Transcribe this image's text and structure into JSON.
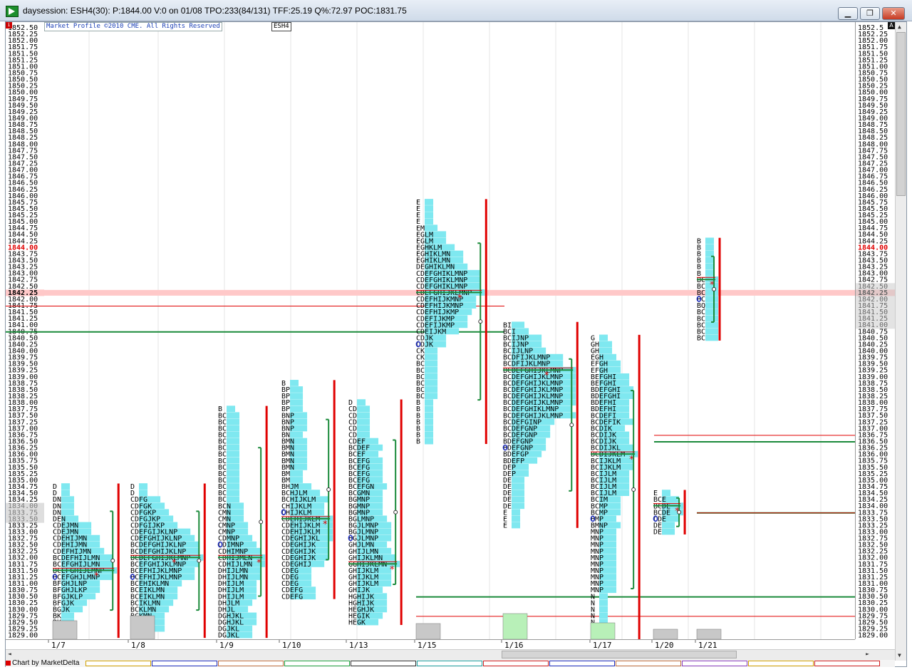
{
  "window": {
    "title": "daysession: ESH4(30): P:1844.00 V:0 on 01/08 TPO:233(84/131) TFF:25.19 Q%:72.97 POC:1831.75",
    "minimize_label": "▁",
    "maximize_label": "❐",
    "close_label": "✕"
  },
  "chart_header": {
    "copyright": "Market Profile ©2010 CME. All Rights Reserved",
    "symbol": "ESH4",
    "left_marker": "i",
    "right_marker": "A"
  },
  "status": {
    "caption": "Chart by MarketDelta",
    "tab_colors": [
      "#d0a000",
      "#1f2fbf",
      "#c07040",
      "#20a040",
      "#303030",
      "#20a0a0",
      "#d02020",
      "#1f2fbf",
      "#c07040",
      "#8a3fbf",
      "#d0a000",
      "#d02020"
    ]
  },
  "scrollbars": {
    "up_icon": "▲",
    "down_icon": "▼",
    "left_icon": "◄",
    "right_icon": "►"
  },
  "price_axis": {
    "labels": [
      "1852.50",
      "1852.25",
      "1852.00",
      "1851.75",
      "1851.50",
      "1851.25",
      "1851.00",
      "1850.75",
      "1850.50",
      "1850.25",
      "1850.00",
      "1849.75",
      "1849.50",
      "1849.25",
      "1849.00",
      "1848.75",
      "1848.50",
      "1848.25",
      "1848.00",
      "1847.75",
      "1847.50",
      "1847.25",
      "1847.00",
      "1846.75",
      "1846.50",
      "1846.25",
      "1846.00",
      "1845.75",
      "1845.50",
      "1845.25",
      "1845.00",
      "1844.75",
      "1844.50",
      "1844.25",
      "1844.00",
      "1843.75",
      "1843.50",
      "1843.25",
      "1843.00",
      "1842.75",
      "1842.50",
      "1842.25",
      "1842.00",
      "1841.75",
      "1841.50",
      "1841.25",
      "1841.00",
      "1840.75",
      "1840.50",
      "1840.25",
      "1840.00",
      "1839.75",
      "1839.50",
      "1839.25",
      "1839.00",
      "1838.75",
      "1838.50",
      "1838.25",
      "1838.00",
      "1837.75",
      "1837.50",
      "1837.25",
      "1837.00",
      "1836.75",
      "1836.50",
      "1836.25",
      "1836.00",
      "1835.75",
      "1835.50",
      "1835.25",
      "1835.00",
      "1834.75",
      "1834.50",
      "1834.25",
      "1834.00",
      "1833.75",
      "1833.50",
      "1833.25",
      "1833.00",
      "1832.75",
      "1832.50",
      "1832.25",
      "1832.00",
      "1831.75",
      "1831.50",
      "1831.25",
      "1831.00",
      "1830.75",
      "1830.50",
      "1830.25",
      "1830.00",
      "1829.75",
      "1829.50",
      "1829.25",
      "1829.00"
    ],
    "right_labels": [
      "1852.5",
      "1852.25",
      "1852.00",
      "1851.75",
      "1851.50",
      "1851.25",
      "1851.00",
      "1850.75",
      "1850.50",
      "1850.25",
      "1850.00",
      "1849.75",
      "1849.50",
      "1849.25",
      "1849.00",
      "1848.75",
      "1848.50",
      "1848.25",
      "1848.00",
      "1847.75",
      "1847.50",
      "1847.25",
      "1847.00",
      "1846.75",
      "1846.50",
      "1846.25",
      "1846.00",
      "1845.75",
      "1845.50",
      "1845.25",
      "1845.00",
      "1844.75",
      "1844.50",
      "1844.25",
      "1844.00",
      "1843.75",
      "1843.50",
      "1843.25",
      "1843.00",
      "1842.75",
      "1842.50",
      "1842.25",
      "1842.00",
      "1841.75",
      "1841.50",
      "1841.25",
      "1841.00",
      "1840.75",
      "1840.50",
      "1840.25",
      "1840.00",
      "1839.75",
      "1839.50",
      "1839.25",
      "1839.00",
      "1838.75",
      "1838.50",
      "1838.25",
      "1838.00",
      "1837.75",
      "1837.50",
      "1837.25",
      "1837.00",
      "1836.75",
      "1836.50",
      "1836.25",
      "1836.00",
      "1835.75",
      "1835.50",
      "1835.25",
      "1835.00",
      "1834.75",
      "1834.50",
      "1834.25",
      "1834.00",
      "1833.75",
      "1833.50",
      "1833.25",
      "1833.00",
      "1832.75",
      "1832.50",
      "1832.25",
      "1832.00",
      "1831.75",
      "1831.50",
      "1831.25",
      "1831.00",
      "1830.75",
      "1830.50",
      "1830.25",
      "1830.00",
      "1829.75",
      "1829.50",
      "1829.25",
      "1829.00"
    ],
    "top_price": 1852.5,
    "tick": 0.25,
    "current_price": "1844.00",
    "highlight_price": "1842.25",
    "colors": {
      "current": "#e00000",
      "highlight_band": "#ffc8c8",
      "shade": "#c8c8c8",
      "text": "#000000"
    }
  },
  "chart_data": {
    "type": "table",
    "colors": {
      "profile_fill": "#7fe8f0",
      "value_area": "#1a8a3a",
      "range_bar": "#e00000",
      "poc": "#1a8a3a",
      "letters": "#000000",
      "volume_bar": "#c8c8c8",
      "volume_bar_green": "#b8f0b8",
      "ib_marker": "#1f2fbf",
      "star": "#e00000"
    },
    "sessions": [
      {
        "date": "1/7",
        "top": 1834.75,
        "rows": [
          "D",
          "D",
          "DN",
          "DN",
          "DN",
          "DEN",
          "CDEJMN",
          "CDEJMN",
          "CDEHIJMN",
          "CDEHIJMN",
          "CDEFHIJMN",
          "BCDEFHIJLMN",
          "BCEFGHIJLMN",
          "BCEFGHIJLMNP",
          "BCEFGHJLMNP",
          "BFGHJLNP",
          "BFGHJLKP",
          "BFGJKLP",
          "BFGJK",
          "BGJK",
          "BK",
          "BK",
          "BK",
          "BK"
        ]
      },
      {
        "date": "1/8",
        "top": 1834.75,
        "rows": [
          "D",
          "D",
          "CDFG",
          "CDFGK",
          "CDFGKP",
          "CDFGJKP",
          "CDFGIJKP",
          "CDEFGIJKLNP",
          "CDEFGHIJKLNP",
          "BCDEFGHIJKLNP",
          "BCDEFGHIJKLNP",
          "BCDEFGHIJKLMNP",
          "BCEFGHIJKLMNP",
          "BCEFHIJKLMNP",
          "BCEFHIJKLMNP",
          "BCEHIKLMN",
          "BCEIKLMN",
          "BCEIKLMN",
          "BCIKLMN",
          "BCKLMN",
          "BCKMN",
          "BCKMN",
          "BCKMN",
          "BK"
        ]
      },
      {
        "date": "1/9",
        "top": 1837.75,
        "rows": [
          "B",
          "BC",
          "BC",
          "BC",
          "BC",
          "BC",
          "BC",
          "BC",
          "BC",
          "BC",
          "BC",
          "BC",
          "BC",
          "BC",
          "BC",
          "BCN",
          "CMN",
          "CMN",
          "CMNP",
          "CMNP",
          "CDMNP",
          "CDIMNP",
          "CDHIMNP",
          "CDHIJMLN",
          "CDHIJLMN",
          "DHIJLMN",
          "DHIJLMN",
          "DHIJLM",
          "DHIJLM",
          "DHIJLM",
          "DHJLM",
          "DHJL",
          "DGHJKL",
          "DGHJKL",
          "DGJKL",
          "DGJKL"
        ]
      },
      {
        "date": "1/10",
        "top": 1838.75,
        "rows": [
          "B",
          "BP",
          "BP",
          "BP",
          "BP",
          "BNP",
          "BNP",
          "BNP",
          "BN",
          "BMN",
          "BMN",
          "BMN",
          "BMN",
          "BMN",
          "BM",
          "BM",
          "BHJM",
          "BCHJLM",
          "BCHIJKLM",
          "CHIJKLM",
          "CHIJKLM",
          "CDEHIJKLM",
          "CDEHIJKLM",
          "CDEHIJKLM",
          "CDEGHIJKL",
          "CDEGHIJK",
          "CDEGHIJK",
          "CDEGHIJK",
          "CDEGHIJ",
          "CDEG",
          "CDEG",
          "CDEG",
          "CDEFG",
          "CDEFG"
        ]
      },
      {
        "date": "1/13",
        "top": 1838.0,
        "rows": [
          "D",
          "CD",
          "CD",
          "CD",
          "CD",
          "CD",
          "CDEF",
          "BCDEF",
          "BCEF",
          "BCEFG",
          "BCEFG",
          "BCEFG",
          "BCEFG",
          "BCEFGN",
          "BCGMN",
          "BGMNP",
          "BGMNP",
          "BGMNP",
          "BGLMNP",
          "BGJLMNP",
          "BGJLMNP",
          "BGJLMNP",
          "GHJLMN",
          "GHIJLMN",
          "GHIJKLMN",
          "GGHIJKLMN",
          "GHIJKLM",
          "GHIJKLM",
          "GHIJKLM",
          "GHIJK",
          "HGHIJK",
          "HGHIJK",
          "HEGHJK",
          "HEGIK",
          "HEGK"
        ]
      },
      {
        "date": "1/15",
        "top": 1845.75,
        "rows": [
          "E",
          "E",
          "E",
          "E",
          "EM",
          "EGLM",
          "EGLM",
          "EGHKLM",
          "EGHIKLMN",
          "EGHIKLMN",
          "DEGHIKLMN",
          "CDEFGHIKLMNP",
          "CDEFGHIKLMNP",
          "CDEFGHIKLMNP",
          "CDEFGHIJKLMNP",
          "CDEFHIJKMNP",
          "CDEFHIJKMNP",
          "CDEFHIJKMP",
          "CDEFIJKMP",
          "CDEFIJKMP",
          "CDEIJKM",
          "CDJK",
          "CDJK",
          "CK",
          "CK",
          "BC",
          "BC",
          "BC",
          "BC",
          "BC",
          "BC",
          "B",
          "B",
          "B",
          "B",
          "B",
          "B",
          "B"
        ]
      },
      {
        "date": "1/16",
        "top": 1841.0,
        "rows": [
          "BI",
          "BCI",
          "BCIJNP",
          "BCIJNP",
          "BCIJLNP",
          "BCDFIJKLMNP",
          "BCDFIJKLMNP",
          "BCDEFGHIJKLMNP",
          "BCDEFGHIJKLMNP",
          "BCDEFGHIJKLMNP",
          "BCDEFGHIJKLMNP",
          "BCDEFGHIJKLMNP",
          "BCDEFGHIJKLMNP",
          "BCDEFGHIKLMNP",
          "BCDEFGHIJKLMNP",
          "BCDEFGINP",
          "BCDEFGNP",
          "BCDEFGNP",
          "BDEFGNP",
          "BDEFGNP",
          "BDEFGP",
          "BDEFP",
          "DEP",
          "DEP",
          "DE",
          "DE",
          "DE",
          "DE",
          "DE",
          "E",
          "E",
          "E"
        ]
      },
      {
        "date": "1/17",
        "top": 1840.5,
        "rows": [
          "G",
          "GH",
          "GH",
          "EGH",
          "EFGH",
          "EFGH",
          "BEFGHI",
          "BEFGHI",
          "BDEFGHI",
          "BDEFGHI",
          "BDEFHI",
          "BDEFHI",
          "BCDEFI",
          "BCDEFIK",
          "BCDIK",
          "BCDIJK",
          "BCDIJK",
          "BCDIJKL",
          "BCDIJKLM",
          "BCIJKLM",
          "BCIJKLM",
          "BCIJLM",
          "BCIJLM",
          "BCIJLM",
          "BCIJLM",
          "BCIM",
          "BCMP",
          "BCMP",
          "BMP",
          "BMNP",
          "MNP",
          "MNP",
          "MNP",
          "MNP",
          "MNP",
          "MNP",
          "MNP",
          "MNP",
          "MNP",
          "MNP",
          "N",
          "N",
          "N",
          "N",
          "N",
          "N",
          "N",
          "N"
        ]
      },
      {
        "date": "1/20",
        "top": 1834.5,
        "rows": [
          "E",
          "BCE",
          "BCDE",
          "BCDE",
          "CDE",
          "DE",
          "DE"
        ]
      },
      {
        "date": "1/21",
        "top": 1844.25,
        "rows": [
          "B",
          "B",
          "B",
          "B",
          "B",
          "B",
          "BC",
          "BC",
          "BC",
          "BC",
          "BQ",
          "BC",
          "BC",
          "BC",
          "BC",
          "BC"
        ]
      }
    ]
  }
}
